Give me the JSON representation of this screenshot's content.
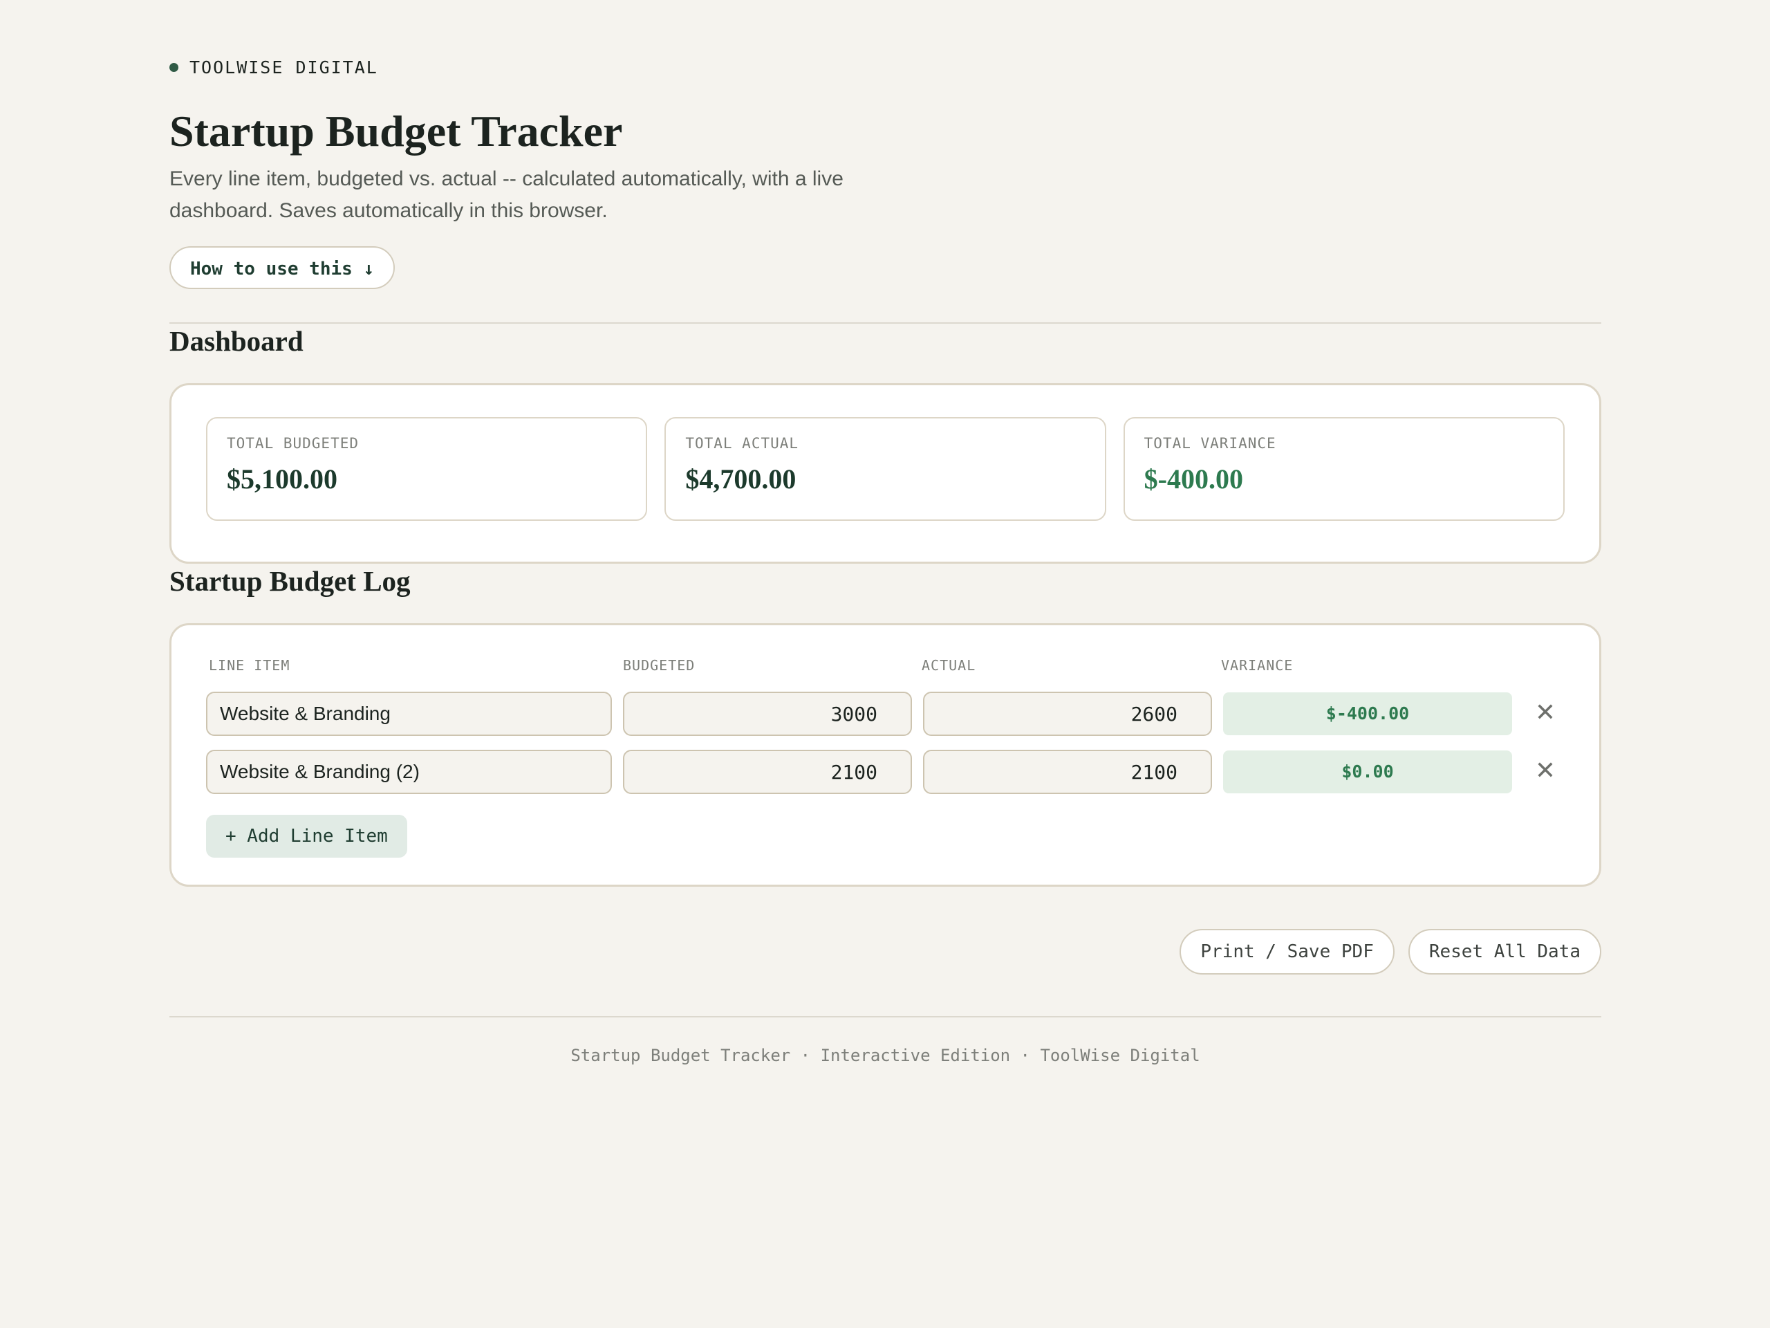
{
  "brand": {
    "name": "TOOLWISE DIGITAL"
  },
  "header": {
    "title": "Startup Budget Tracker",
    "subtitle": "Every line item, budgeted vs. actual -- calculated automatically, with a live dashboard. Saves automatically in this browser.",
    "howto_label": "How to use this ↓"
  },
  "dashboard": {
    "title": "Dashboard",
    "cards": [
      {
        "label": "TOTAL BUDGETED",
        "value": "$5,100.00"
      },
      {
        "label": "TOTAL ACTUAL",
        "value": "$4,700.00"
      },
      {
        "label": "TOTAL VARIANCE",
        "value": "$-400.00"
      }
    ]
  },
  "log": {
    "title": "Startup Budget Log",
    "columns": [
      "LINE ITEM",
      "BUDGETED",
      "ACTUAL",
      "VARIANCE"
    ],
    "rows": [
      {
        "item": "Website & Branding",
        "budgeted": "3000",
        "actual": "2600",
        "variance": "$-400.00",
        "delete": "✕"
      },
      {
        "item": "Website & Branding (2)",
        "budgeted": "2100",
        "actual": "2100",
        "variance": "$0.00",
        "delete": "✕"
      }
    ],
    "add_label": "+ Add Line Item"
  },
  "actions": {
    "print_label": "Print / Save PDF",
    "reset_label": "Reset All Data"
  },
  "footer": {
    "text": "Startup Budget Tracker · Interactive Edition · ToolWise Digital"
  },
  "colors": {
    "background": "#f5f3ee",
    "accent": "#2f5a45",
    "positive": "#2d7a4f",
    "variance_bg": "#e3efe5"
  }
}
